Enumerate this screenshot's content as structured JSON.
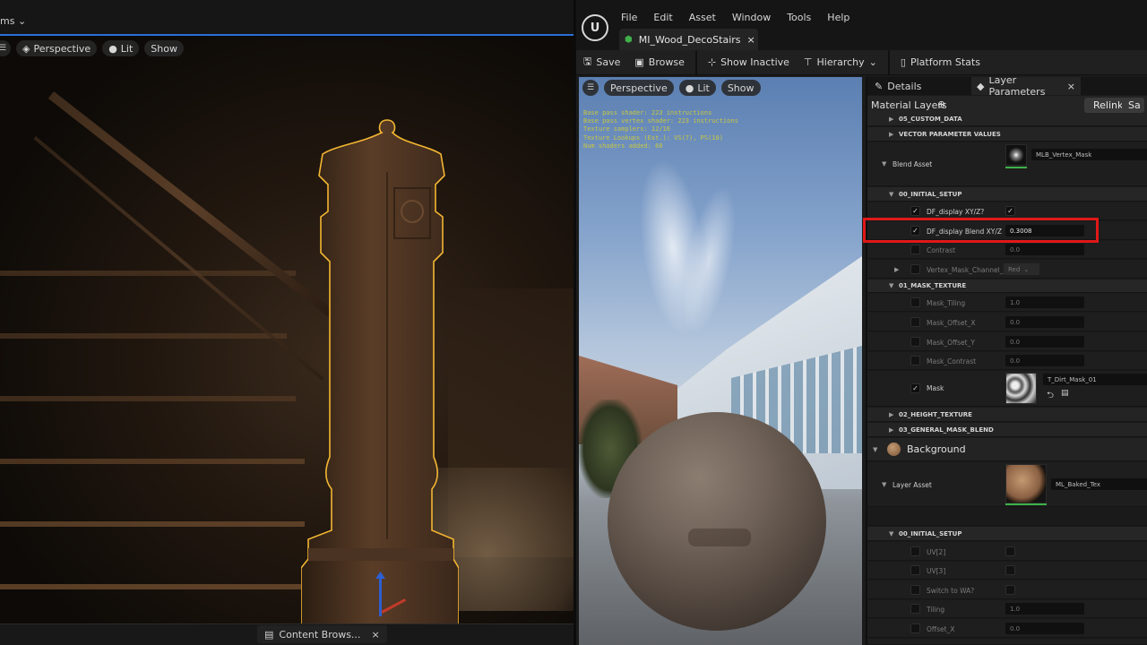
{
  "left_viewport": {
    "menu_fragment": "ms",
    "buttons": {
      "perspective": "Perspective",
      "lit": "Lit",
      "show": "Show"
    },
    "bottom_tab": {
      "label": "Content Brows...",
      "close": "×"
    }
  },
  "editor": {
    "menu": [
      "File",
      "Edit",
      "Asset",
      "Window",
      "Tools",
      "Help"
    ],
    "asset_tab": {
      "label": "MI_Wood_DecoStairs",
      "close": "×"
    },
    "toolbar": {
      "save": "Save",
      "browse": "Browse",
      "show_inactive": "Show Inactive",
      "hierarchy": "Hierarchy",
      "platform_stats": "Platform Stats"
    },
    "preview": {
      "buttons": {
        "perspective": "Perspective",
        "lit": "Lit",
        "show": "Show"
      },
      "stats": [
        "Base pass shader: 223 instructions",
        "Base pass vertex shader: 223 instructions",
        "Texture samplers: 12/16",
        "Texture Lookups (Est.): VS(7), PS(18)",
        "Num shaders added: 60"
      ]
    },
    "details": {
      "tabs": {
        "details": "Details",
        "layer_parameters": "Layer Parameters",
        "close": "×"
      },
      "header": {
        "title": "Material Layers",
        "relink": "Relink",
        "save_fragment": "Sa"
      },
      "rows": {
        "custom_data": "05_CUSTOM_DATA",
        "vector_params": "VECTOR PARAMETER VALUES",
        "blend_asset_label": "Blend Asset",
        "blend_asset_value": "MLB_Vertex_Mask",
        "initial_setup": "00_INITIAL_SETUP",
        "df_display": "DF_display XY/Z?",
        "df_blend": "DF_display Blend XY/Z",
        "df_blend_value": "0.3008",
        "contrast": "Contrast",
        "contrast_value": "0.0",
        "vertex_mask_channel": "Vertex_Mask_Channel_Se",
        "vertex_mask_channel_value": "Red",
        "mask_texture": "01_MASK_TEXTURE",
        "mask_tiling": "Mask_Tiling",
        "mask_tiling_value": "1.0",
        "mask_offset_x": "Mask_Offset_X",
        "mask_offset_x_value": "0.0",
        "mask_offset_y": "Mask_Offset_Y",
        "mask_offset_y_value": "0.0",
        "mask_contrast": "Mask_Contrast",
        "mask_contrast_value": "0.0",
        "mask": "Mask",
        "mask_value": "T_Dirt_Mask_01",
        "height_texture": "02_HEIGHT_TEXTURE",
        "general_mask_blend": "03_GENERAL_MASK_BLEND",
        "background": "Background",
        "layer_asset_label": "Layer Asset",
        "layer_asset_value": "ML_Baked_Tex",
        "initial_setup_2": "00_INITIAL_SETUP",
        "uv2": "UV[2]",
        "uv3": "UV[3]",
        "switch_wa": "Switch to WA?",
        "tiling": "Tiling",
        "tiling_value": "1.0",
        "offset_x": "Offset_X",
        "offset_x_value": "0.0"
      }
    }
  },
  "colors": {
    "accent_blue": "#2c6fd6",
    "selection_outline": "#f2b632",
    "highlight_red": "#e01818",
    "stats_text": "#c7c742"
  }
}
